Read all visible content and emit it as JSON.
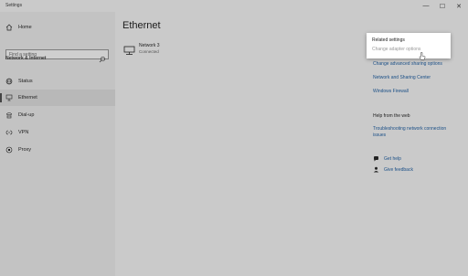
{
  "window": {
    "title": "Settings",
    "controls": {
      "minimize": "—",
      "maximize": "☐",
      "close": "✕"
    }
  },
  "sidebar": {
    "home_label": "Home",
    "search_placeholder": "Find a setting",
    "section_label": "Network & Internet",
    "items": [
      {
        "label": "Status",
        "icon": "globe-icon"
      },
      {
        "label": "Ethernet",
        "icon": "ethernet-icon",
        "selected": true
      },
      {
        "label": "Dial-up",
        "icon": "dialup-icon"
      },
      {
        "label": "VPN",
        "icon": "vpn-icon"
      },
      {
        "label": "Proxy",
        "icon": "proxy-icon"
      }
    ]
  },
  "main": {
    "title": "Ethernet",
    "network": {
      "name": "Network 3",
      "status": "Connected"
    }
  },
  "related_settings": {
    "heading": "Related settings",
    "links": [
      "Change adapter options",
      "Change advanced sharing options",
      "Network and Sharing Center",
      "Windows Firewall"
    ]
  },
  "help": {
    "heading": "Help from the web",
    "link_line1": "Troubleshooting network connection",
    "link_line2": "issues",
    "get_help": "Get help",
    "give_feedback": "Give feedback"
  },
  "colors": {
    "link": "#1a4f87",
    "background": "#cacaca",
    "popup": "#ffffff"
  }
}
